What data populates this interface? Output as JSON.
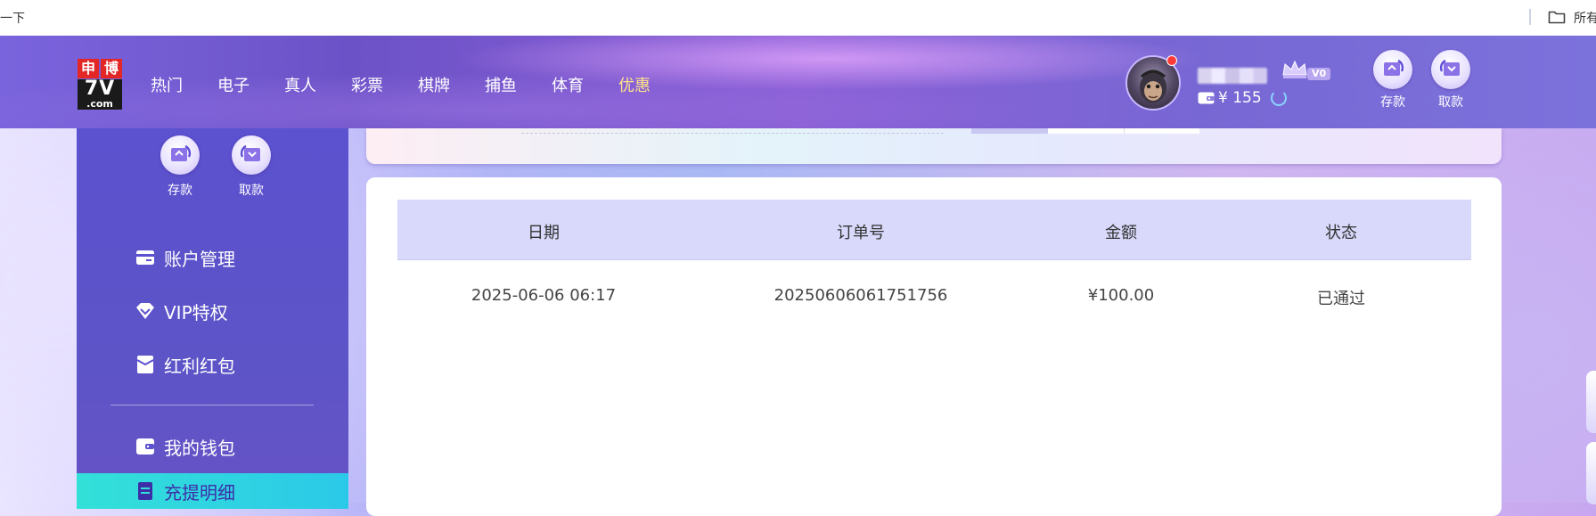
{
  "browser": {
    "bookmark_left": "一下",
    "bookmark_right": "所有"
  },
  "brand": {
    "logo_line1_a": "申",
    "logo_line1_b": "博",
    "logo_line2": "7V",
    "logo_line3": ".com"
  },
  "nav": {
    "items": [
      "热门",
      "电子",
      "真人",
      "彩票",
      "棋牌",
      "捕鱼",
      "体育",
      "优惠"
    ],
    "active_index": 7
  },
  "user": {
    "vip_level": "V0",
    "balance": "¥ 155"
  },
  "header_actions": {
    "deposit": "存款",
    "withdraw": "取款"
  },
  "sidebar": {
    "deposit": "存款",
    "withdraw": "取款",
    "items": [
      "账户管理",
      "VIP特权",
      "红利红包",
      "我的钱包",
      "充提明细"
    ],
    "active_index": 4
  },
  "records_table": {
    "columns": [
      "日期",
      "订单号",
      "金额",
      "状态"
    ],
    "rows": [
      [
        "2025-06-06 06:17",
        "20250606061751756",
        "¥100.00",
        "已通过"
      ]
    ]
  },
  "colors": {
    "accent_yellow": "#ffe38a",
    "sidebar_bg": "#5c51cf",
    "active_item": "#2bc9e8",
    "table_header": "#d8d9fb"
  }
}
